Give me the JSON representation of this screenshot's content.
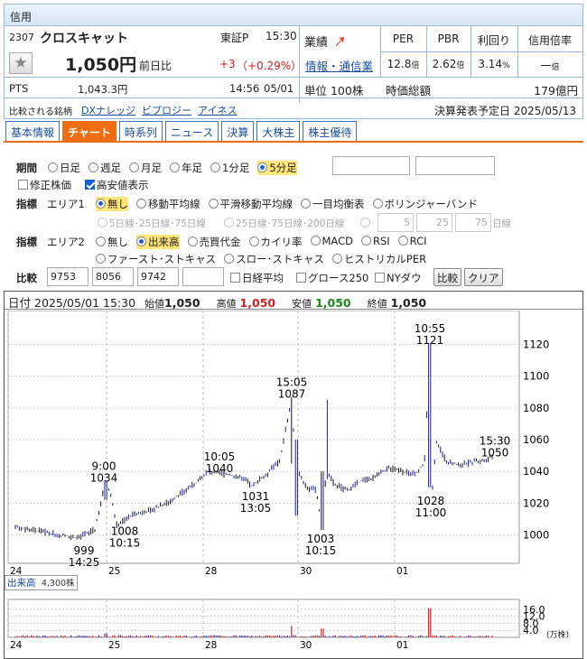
{
  "header": {
    "section": "信用",
    "code": "2307",
    "name": "クロスキャット",
    "market": "東証P",
    "time": "15:30",
    "price": "1,050円",
    "prev_label": "前日比",
    "change": "+3",
    "change_pct": "（+0.29%）",
    "pts_label": "PTS",
    "pts_price": "1,043.3円",
    "pts_time": "14:56",
    "pts_date": "05/01",
    "compare_label": "比較される銘柄",
    "compare_links": [
      "DXナレッジ",
      "ビプロジー",
      "アイネス"
    ],
    "gyoseki": "業績",
    "industry": "情報・通信業",
    "unit": "単位 100株",
    "per_label": "PER",
    "pbr_label": "PBR",
    "yield_label": "利回り",
    "margin_label": "信用倍率",
    "per": "12.8",
    "per_unit": "倍",
    "pbr": "2.62",
    "pbr_unit": "倍",
    "yield": "3.14",
    "yield_unit": "%",
    "margin": "一",
    "margin_unit": "倍",
    "mcap_label": "時価総額",
    "mcap": "179億円",
    "earnings_date": "決算発表予定日  2025/05/13"
  },
  "tabs": [
    "基本情報",
    "チャート",
    "時系列",
    "ニュース",
    "決算",
    "大株主",
    "株主優待"
  ],
  "controls": {
    "period_label": "期間",
    "periods": [
      "日足",
      "週足",
      "月足",
      "年足",
      "1分足",
      "5分足"
    ],
    "adjusted": "修正株価",
    "highlow": "高安値表示",
    "indicator_label": "指標",
    "area1_label": "エリア1",
    "area1_options": [
      "無し",
      "移動平均線",
      "平滑移動平均線",
      "一目均衡表",
      "ボリンジャーバンド"
    ],
    "ma_opt1": "5日線･25日線･75日線",
    "ma_opt2": "25日線･75日線･200日線",
    "ma_v1": "5",
    "ma_v2": "25",
    "ma_v3": "75",
    "ma_unit": "日線",
    "area2_label": "エリア2",
    "area2_row1": [
      "無し",
      "出来高",
      "売買代金",
      "カイリ率",
      "MACD",
      "RSI",
      "RCI"
    ],
    "area2_row2": [
      "ファースト･ストキャス",
      "スロー･ストキャス",
      "ヒストリカルPER"
    ],
    "compare_label": "比較",
    "compare_codes": [
      "9753",
      "8056",
      "9742",
      ""
    ],
    "nikkei": "日経平均",
    "growth": "グロース250",
    "nydow": "NYダウ",
    "compare_btn": "比較",
    "clear_btn": "クリア"
  },
  "chart_info": {
    "date_label": "日付",
    "datetime": "2025/05/01 15:30",
    "open_label": "始値",
    "open": "1,050",
    "high_label": "高値",
    "high": "1,050",
    "low_label": "安値",
    "low": "1,050",
    "close_label": "終値",
    "close": "1,050"
  },
  "volume_label": "出来高",
  "volume_value": "4,300株",
  "volume_unit": "(万株)",
  "chart_data": {
    "type": "line",
    "y_axis": [
      1000,
      1020,
      1040,
      1060,
      1080,
      1100,
      1120
    ],
    "ylim": [
      982,
      1138
    ],
    "x_day_labels": [
      "24",
      "25",
      "28",
      "30",
      "01"
    ],
    "annotations": [
      {
        "time": "14:25",
        "value": "999"
      },
      {
        "time": "9:00",
        "value": "1034"
      },
      {
        "time": "10:15",
        "value": "1008"
      },
      {
        "time": "10:05",
        "value": "1040"
      },
      {
        "time": "13:05",
        "value": "1031"
      },
      {
        "time": "15:05",
        "value": "1087"
      },
      {
        "time": "10:15",
        "value": "1003"
      },
      {
        "time": "10:55",
        "value": "1121"
      },
      {
        "time": "11:00",
        "value": "1028"
      },
      {
        "time": "15:30",
        "value": "1050"
      }
    ],
    "volume_axis": [
      4.0,
      8.0,
      12.0,
      16.0
    ],
    "volume_ylim": [
      0,
      19
    ]
  },
  "colors": {
    "up": "#1a1aa8",
    "down": "#111111",
    "vol_blue": "#2828b8",
    "vol_red": "#d42020",
    "accent": "#ee6d12",
    "high_red": "#d42020",
    "low_green": "#1a8a1a"
  }
}
